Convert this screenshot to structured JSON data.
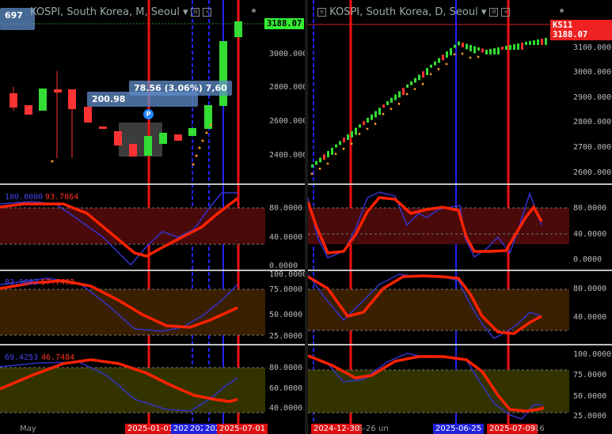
{
  "left": {
    "title": "KOSPI, South Korea, M, Seoul",
    "corner_label": "697",
    "price_label": "3188.07",
    "y_ticks": [
      "3000.000",
      "2800.000",
      "2600.000",
      "2400.000"
    ],
    "tip_top": "78.56 (3.06%) 7,60",
    "tip_bottom": "200.98",
    "p_marker": "P",
    "x_label": "May",
    "osc1": {
      "v1": "100.0000",
      "v2": "93.7864",
      "ticks": [
        "80.0000",
        "40.0000",
        "0.0000"
      ]
    },
    "osc2": {
      "v1": "83.9683",
      "v2": "57.7462",
      "ticks": [
        "100.0000",
        "75.0000",
        "50.0000",
        "25.0000"
      ]
    },
    "osc3": {
      "v1": "69.4253",
      "v2": "46.7484",
      "ticks": [
        "80.0000",
        "60.0000",
        "40.0000"
      ]
    },
    "dates": [
      "2025-01-01",
      "202",
      "202",
      "202",
      "2025-07-01"
    ]
  },
  "right": {
    "title": "KOSPI, South Korea, D, Seoul",
    "price_label_sym": "KS11",
    "price_label": "3188.07",
    "y_ticks": [
      "3100.000",
      "3000.000",
      "2900.000",
      "2800.000",
      "2700.000",
      "2600.000"
    ],
    "osc1": {
      "ticks": [
        "80.0000",
        "40.0000",
        "0.0000"
      ]
    },
    "osc2": {
      "ticks": [
        "80.0000",
        "40.0000"
      ]
    },
    "osc3": {
      "ticks": [
        "100.0000",
        "75.0000",
        "50.0000",
        "25.0000"
      ]
    },
    "dates": [
      "2024-12-30",
      "5-26",
      "un",
      "2025-06-25",
      "2025-07-09",
      "16"
    ]
  },
  "colors": {
    "bull": "#33dd33",
    "bear": "#ff3333",
    "red_line": "#ee1111",
    "blue_line": "#2222ee",
    "osc_red": "#ff2200",
    "osc_blue": "#3333cc"
  }
}
